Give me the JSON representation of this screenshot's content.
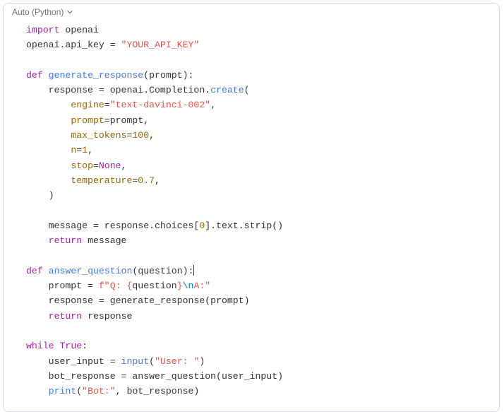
{
  "header": {
    "language_label": "Auto (Python)"
  },
  "code": {
    "import_kw": "import",
    "openai_mod": "openai",
    "api_key_assign": "openai.api_key = ",
    "api_key_str": "\"YOUR_API_KEY\"",
    "def_kw": "def",
    "fn_generate": "generate_response",
    "param_prompt": "prompt",
    "resp_assign": "response = openai.Completion.",
    "create_call": "create",
    "engine_param": "engine",
    "engine_val": "\"text-davinci-002\"",
    "prompt_param": "prompt",
    "prompt_val": "prompt,",
    "max_tokens_param": "max_tokens",
    "max_tokens_val": "100",
    "n_param": "n",
    "n_val": "1",
    "stop_param": "stop",
    "none_kw": "None",
    "temperature_param": "temperature",
    "temperature_val": "0.7",
    "msg_assign": "message = response.choices[",
    "idx0": "0",
    "msg_tail": "].text.strip()",
    "return_kw": "return",
    "return_msg": "message",
    "fn_answer": "answer_question",
    "param_question": "question",
    "prompt2_assign": "prompt = ",
    "fstr_prefix": "f\"Q: ",
    "fstr_braces_open": "{",
    "fstr_question": "question",
    "fstr_braces_close": "}",
    "fstr_esc": "\\n",
    "fstr_suffix": "A:\"",
    "resp2_assign": "response = generate_response(prompt)",
    "return_resp": "response",
    "while_kw": "while",
    "true_kw": "True",
    "user_input_assign": "user_input = ",
    "input_builtin": "input",
    "user_prompt_str": "\"User: \"",
    "bot_resp_assign": "bot_response = answer_question(user_input)",
    "print_builtin": "print",
    "bot_str": "\"Bot:\"",
    "print_tail": ", bot_response)"
  }
}
